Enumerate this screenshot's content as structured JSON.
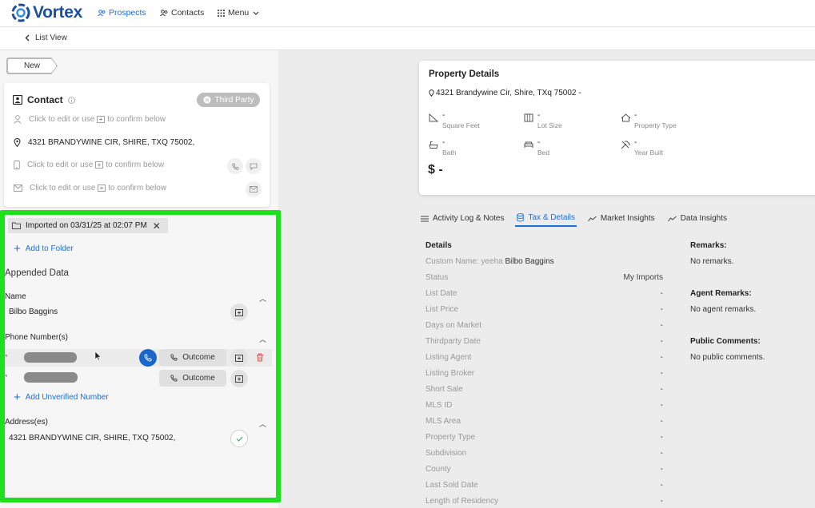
{
  "nav": {
    "brand": "Vortex",
    "prospects": "Prospects",
    "contacts": "Contacts",
    "menu": "Menu",
    "back": "List View"
  },
  "left": {
    "new_tag": "New",
    "contact": {
      "title": "Contact",
      "badge": "Third Party",
      "name_placeholder_a": "Click to edit or use",
      "name_placeholder_b": "to confirm below",
      "address": "4321 BRANDYWINE CIR, SHIRE, TXQ 75002,",
      "phone_placeholder_a": "Click to edit or use",
      "phone_placeholder_b": "to confirm below",
      "email_placeholder_a": "Click to edit or use",
      "email_placeholder_b": "to confirm below"
    },
    "import_chip": "Imported on 03/31/25 at 02:07 PM",
    "add_folder": "Add to Folder",
    "appended_title": "Appended Data",
    "name_label": "Name",
    "name_value": "Bilbo Baggins",
    "phones_label": "Phone Number(s)",
    "phone_marker": "*",
    "outcome": "Outcome",
    "add_unverified": "Add Unverified Number",
    "address_label": "Address(es)",
    "address_value": "4321 BRANDYWINE CIR, SHIRE, TXQ 75002,"
  },
  "property": {
    "title": "Property Details",
    "address": "4321 Brandywine Cir, Shire, TXq 75002 -",
    "stats": {
      "sqft": {
        "value": "-",
        "label": "Square Feet"
      },
      "lot": {
        "value": "-",
        "label": "Lot Size"
      },
      "type": {
        "value": "-",
        "label": "Property Type"
      },
      "bath": {
        "value": "-",
        "label": "Bath"
      },
      "bed": {
        "value": "-",
        "label": "Bed"
      },
      "year": {
        "value": "-",
        "label": "Year Built"
      }
    },
    "price": "$ -"
  },
  "tabs": [
    "Activity Log & Notes",
    "Tax & Details",
    "Market Insights",
    "Data Insights"
  ],
  "details": {
    "heading": "Details",
    "custom_name_label": "Custom Name: yeeha",
    "custom_name_value": "Bilbo Baggins",
    "rows": [
      {
        "label": "Status",
        "value": "My Imports"
      },
      {
        "label": "List Date",
        "value": "-"
      },
      {
        "label": "List Price",
        "value": "-"
      },
      {
        "label": "Days on Market",
        "value": "-"
      },
      {
        "label": "Thirdparty Date",
        "value": "-"
      },
      {
        "label": "Listing Agent",
        "value": "-"
      },
      {
        "label": "Listing Broker",
        "value": "-"
      },
      {
        "label": "Short Sale",
        "value": "-"
      },
      {
        "label": "MLS ID",
        "value": "-"
      },
      {
        "label": "MLS Area",
        "value": "-"
      },
      {
        "label": "Property Type",
        "value": "-"
      },
      {
        "label": "Subdivision",
        "value": "-"
      },
      {
        "label": "County",
        "value": "-"
      },
      {
        "label": "Last Sold Date",
        "value": "-"
      },
      {
        "label": "Length of Residency",
        "value": "-"
      }
    ]
  },
  "remarks": {
    "remarks_title": "Remarks:",
    "remarks_text": "No remarks.",
    "agent_title": "Agent Remarks:",
    "agent_text": "No agent remarks.",
    "public_title": "Public Comments:",
    "public_text": "No public comments."
  },
  "colors": {
    "brand": "#1d4f9e",
    "accent": "#1f6fd1",
    "highlight": "#1ee01e"
  }
}
